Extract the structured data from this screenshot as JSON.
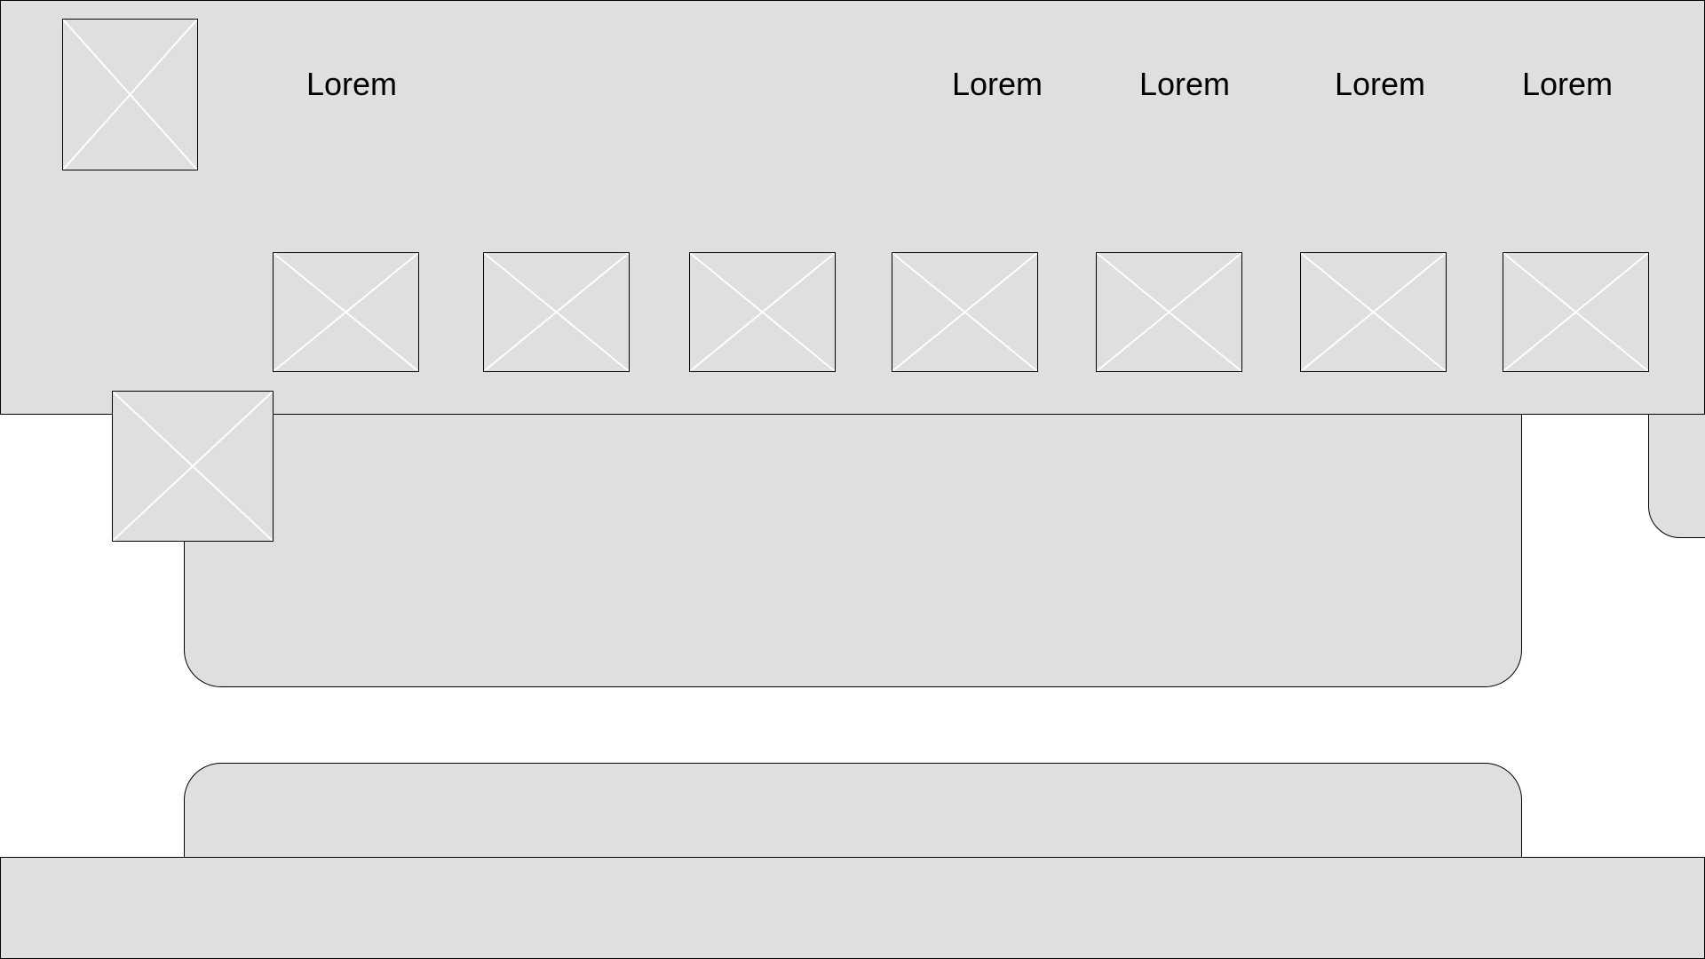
{
  "header": {
    "brand_label": "Lorem",
    "nav": [
      {
        "label": "Lorem"
      },
      {
        "label": "Lorem"
      },
      {
        "label": "Lorem"
      },
      {
        "label": "Lorem"
      }
    ]
  },
  "colors": {
    "panel_fill": "#dfdfdf",
    "border": "#000000",
    "placeholder_cross": "#ffffff",
    "text": "#000000"
  },
  "icons": {
    "placeholder": "image-placeholder-icon"
  }
}
